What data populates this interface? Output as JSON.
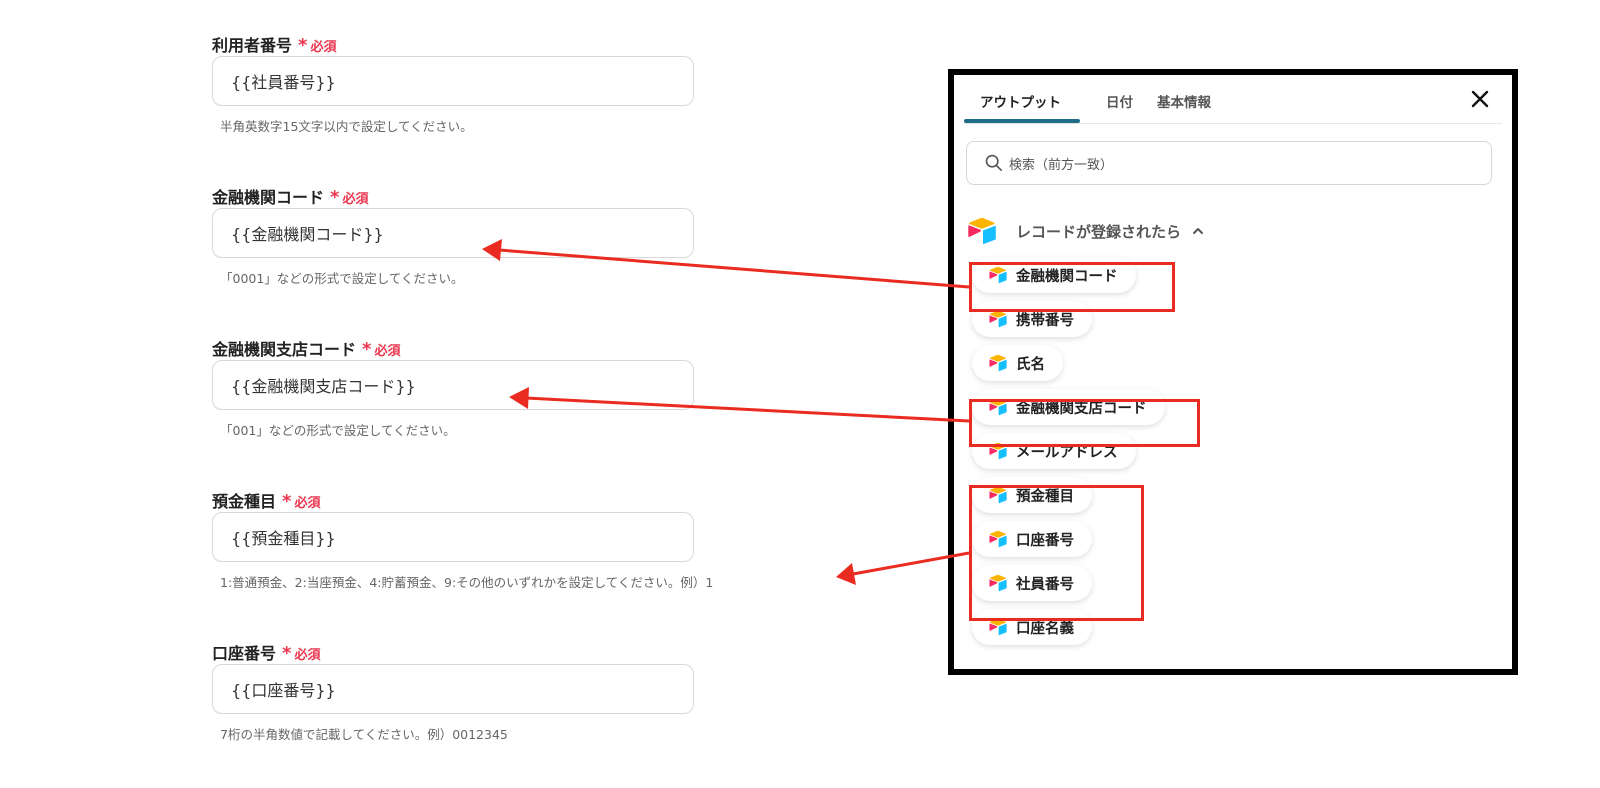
{
  "form": {
    "required_star": "*",
    "fields": [
      {
        "label": "利用者番号",
        "required_label": "必須",
        "value": "{{社員番号}}",
        "hint": "半角英数字15文字以内で設定してください。"
      },
      {
        "label": "金融機関コード",
        "required_label": "必須",
        "value": "{{金融機関コード}}",
        "hint": "「0001」などの形式で設定してください。"
      },
      {
        "label": "金融機関支店コード",
        "required_label": "必須",
        "value": "{{金融機関支店コード}}",
        "hint": "「001」などの形式で設定してください。"
      },
      {
        "label": "預金種目",
        "required_label": "必須",
        "value": "{{預金種目}}",
        "hint": "1:普通預金、2:当座預金、4:貯蓄預金、9:その他のいずれかを設定してください。例）1"
      },
      {
        "label": "口座番号",
        "required_label": "必須",
        "value": "{{口座番号}}",
        "hint": "7桁の半角数値で記載してください。例）0012345"
      }
    ]
  },
  "panel": {
    "tabs": [
      {
        "label": "アウトプット",
        "active": true
      },
      {
        "label": "日付",
        "active": false
      },
      {
        "label": "基本情報",
        "active": false
      }
    ],
    "close_icon": "close-icon",
    "search_placeholder": "検索（前方一致）",
    "group": {
      "title": "レコードが登録されたら",
      "icon": "airtable-logo-icon",
      "expanded": true
    },
    "items": [
      "金融機関コード",
      "携帯番号",
      "氏名",
      "金融機関支店コード",
      "メールアドレス",
      "預金種目",
      "口座番号",
      "社員番号",
      "口座名義"
    ]
  },
  "colors": {
    "required": "#e8384f",
    "tab_indicator": "#1f6d86",
    "annotation": "#ea2b1f",
    "logo_yellow": "#fcb400",
    "logo_red": "#f82b60",
    "logo_blue": "#18bfff"
  }
}
